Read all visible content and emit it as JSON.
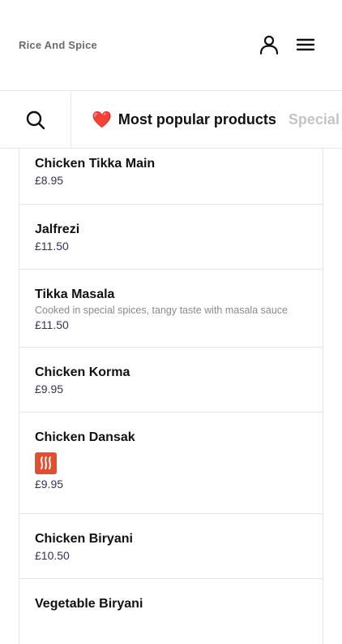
{
  "header": {
    "brand": "Rice And Spice",
    "user_icon": "user-icon",
    "menu_icon": "hamburger-menu-icon"
  },
  "category_bar": {
    "search_icon": "search-icon",
    "tabs": [
      {
        "emoji": "❤️",
        "label": "Most popular products",
        "active": true
      },
      {
        "emoji": "",
        "label": "Special",
        "active": false
      }
    ]
  },
  "products": [
    {
      "name": "Chicken Tikka Main",
      "description": "",
      "price": "£8.95"
    },
    {
      "name": "Jalfrezi",
      "description": "",
      "price": "£11.50"
    },
    {
      "name": "Tikka Masala",
      "description": "Cooked in special spices, tangy taste with masala sauce",
      "price": "£11.50"
    },
    {
      "name": "Chicken Korma",
      "description": "",
      "price": "£9.95"
    },
    {
      "name": "Chicken Dansak",
      "description": "",
      "price": "£9.95",
      "badge_icon": "spicy-icon"
    },
    {
      "name": "Chicken Biryani",
      "description": "",
      "price": "£10.50"
    },
    {
      "name": "Vegetable Biryani",
      "description": "",
      "price": ""
    }
  ],
  "colors": {
    "accent_spicy": "#e34e2f",
    "heart": "#d81e2c",
    "price_text": "#333355"
  }
}
